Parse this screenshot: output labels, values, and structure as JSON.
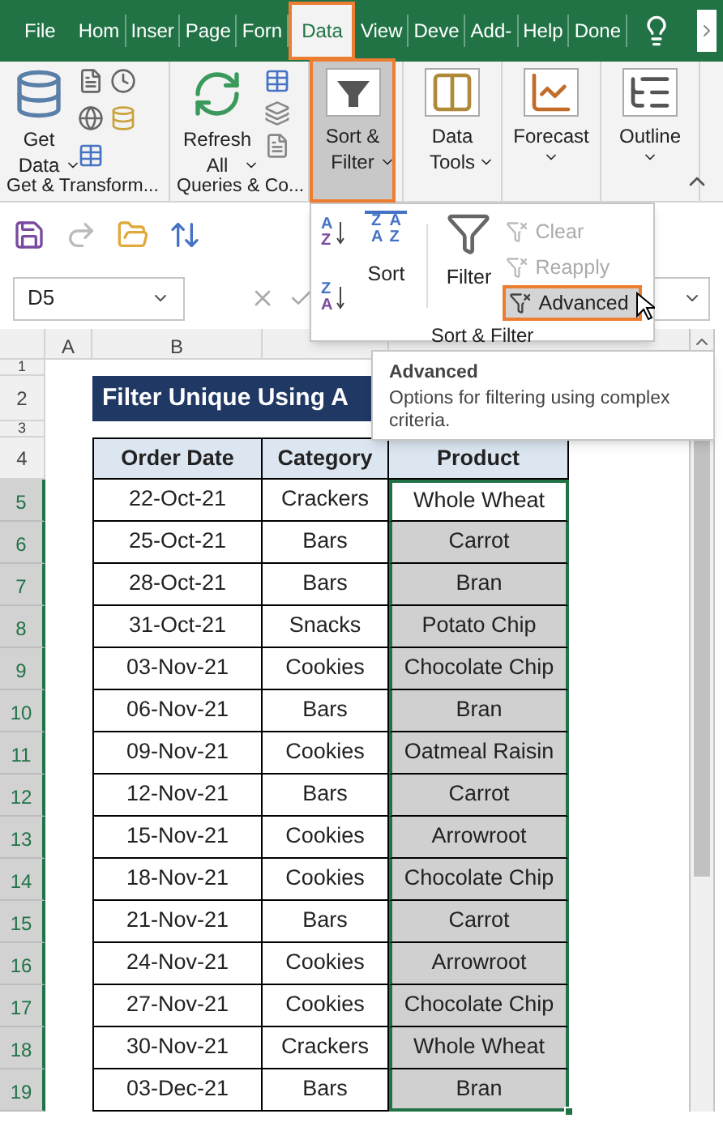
{
  "tabs": [
    {
      "label": "File",
      "selected": false
    },
    {
      "label": "Hom",
      "selected": false
    },
    {
      "label": "Inser",
      "selected": false
    },
    {
      "label": "Page",
      "selected": false
    },
    {
      "label": "Forn",
      "selected": false
    },
    {
      "label": "Data",
      "selected": true
    },
    {
      "label": "View",
      "selected": false
    },
    {
      "label": "Deve",
      "selected": false
    },
    {
      "label": "Add-",
      "selected": false
    },
    {
      "label": "Help",
      "selected": false
    },
    {
      "label": "Done",
      "selected": false
    }
  ],
  "ribbon": {
    "groups": [
      {
        "kind": "getdata",
        "label": "Get & Transform...",
        "button": {
          "lines": [
            "Get",
            "Data"
          ],
          "selected": false
        }
      },
      {
        "kind": "queries",
        "label": "Queries & Co...",
        "button": {
          "lines": [
            "Refresh",
            "All"
          ],
          "selected": false
        }
      },
      {
        "kind": "sortfilter",
        "button": {
          "lines": [
            "Sort &",
            "Filter"
          ],
          "selected": true
        }
      },
      {
        "kind": "datatools",
        "button": {
          "lines": [
            "Data",
            "Tools"
          ],
          "selected": false
        }
      },
      {
        "kind": "forecast",
        "button": {
          "lines": [
            "Forecast"
          ],
          "selected": false
        }
      },
      {
        "kind": "outline",
        "button": {
          "lines": [
            "Outline"
          ],
          "selected": false
        }
      }
    ]
  },
  "sort_filter_menu": {
    "sort_icons": [
      {
        "letters": [
          "A",
          "Z"
        ]
      },
      {
        "letters": [
          "Z",
          "A"
        ]
      }
    ],
    "sort_grid_letters": [
      "Z",
      "A",
      "A",
      "Z"
    ],
    "sort_label": "Sort",
    "filter_label": "Filter",
    "commands": [
      {
        "label": "Clear",
        "disabled": true,
        "highlighted": false
      },
      {
        "label": "Reapply",
        "disabled": true,
        "highlighted": false
      },
      {
        "label": "Advanced",
        "disabled": false,
        "highlighted": true
      }
    ],
    "group_label": "Sort & Filter"
  },
  "name_box": "D5",
  "column_headers": [
    "A",
    "B"
  ],
  "tooltip": {
    "title": "Advanced",
    "text": "Options for filtering using complex criteria."
  },
  "sheet": {
    "title": "Filter Unique Using A",
    "columns": [
      "Order Date",
      "Category",
      "Product"
    ],
    "rows": [
      {
        "row": "5",
        "date": "22-Oct-21",
        "category": "Crackers",
        "product": "Whole Wheat",
        "active": true
      },
      {
        "row": "6",
        "date": "25-Oct-21",
        "category": "Bars",
        "product": "Carrot",
        "active": false
      },
      {
        "row": "7",
        "date": "28-Oct-21",
        "category": "Bars",
        "product": "Bran",
        "active": false
      },
      {
        "row": "8",
        "date": "31-Oct-21",
        "category": "Snacks",
        "product": "Potato Chip",
        "active": false
      },
      {
        "row": "9",
        "date": "03-Nov-21",
        "category": "Cookies",
        "product": "Chocolate Chip",
        "active": false
      },
      {
        "row": "10",
        "date": "06-Nov-21",
        "category": "Bars",
        "product": "Bran",
        "active": false
      },
      {
        "row": "11",
        "date": "09-Nov-21",
        "category": "Cookies",
        "product": "Oatmeal Raisin",
        "active": false
      },
      {
        "row": "12",
        "date": "12-Nov-21",
        "category": "Bars",
        "product": "Carrot",
        "active": false
      },
      {
        "row": "13",
        "date": "15-Nov-21",
        "category": "Cookies",
        "product": "Arrowroot",
        "active": false
      },
      {
        "row": "14",
        "date": "18-Nov-21",
        "category": "Cookies",
        "product": "Chocolate Chip",
        "active": false
      },
      {
        "row": "15",
        "date": "21-Nov-21",
        "category": "Bars",
        "product": "Carrot",
        "active": false
      },
      {
        "row": "16",
        "date": "24-Nov-21",
        "category": "Cookies",
        "product": "Arrowroot",
        "active": false
      },
      {
        "row": "17",
        "date": "27-Nov-21",
        "category": "Cookies",
        "product": "Chocolate Chip",
        "active": false
      },
      {
        "row": "18",
        "date": "30-Nov-21",
        "category": "Crackers",
        "product": "Whole Wheat",
        "active": false
      },
      {
        "row": "19",
        "date": "03-Dec-21",
        "category": "Bars",
        "product": "Bran",
        "active": false
      }
    ],
    "top_rows": [
      "1",
      "2",
      "3",
      "4"
    ]
  }
}
